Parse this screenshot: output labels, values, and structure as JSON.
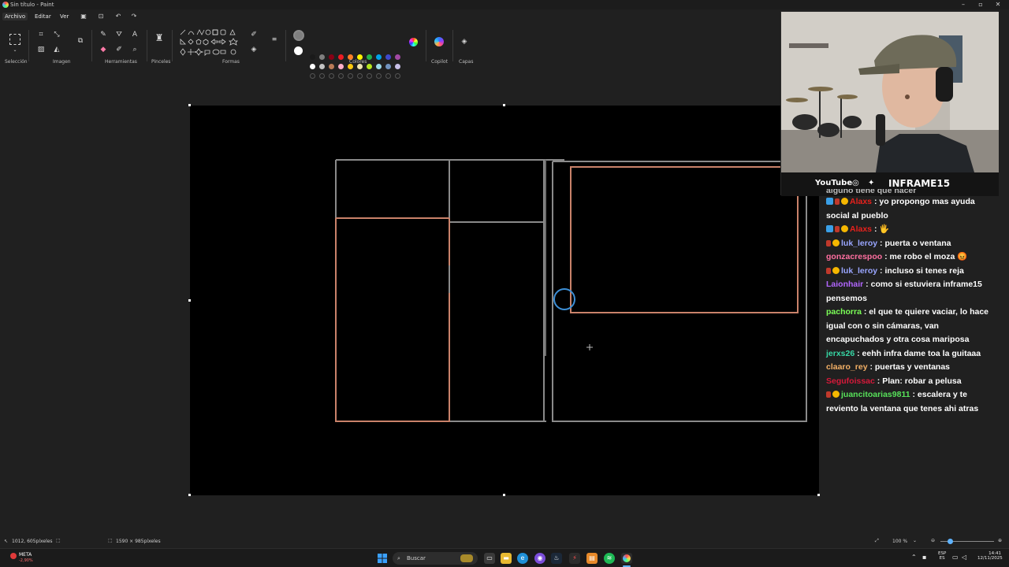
{
  "window": {
    "title": "Sin título - Paint"
  },
  "menu": {
    "file": "Archivo",
    "edit": "Editar",
    "view": "Ver"
  },
  "ribbon": {
    "groups": {
      "selection": "Selección",
      "image": "Imagen",
      "tools": "Herramientas",
      "brushes": "Pinceles",
      "shapes": "Formas",
      "colors": "Colores",
      "copilot": "Copilot",
      "layers": "Capas"
    },
    "palette_row1": [
      "#1a1a1a",
      "#7f7f7f",
      "#880015",
      "#ed1c24",
      "#ff7f27",
      "#fff200",
      "#22b14c",
      "#00a2e8",
      "#3f48cc",
      "#a349a4"
    ],
    "palette_row2": [
      "#ffffff",
      "#c3c3c3",
      "#b97a57",
      "#ffaec9",
      "#ffc90e",
      "#efe4b0",
      "#b5e61d",
      "#99d9ea",
      "#7092be",
      "#c8bfe7"
    ],
    "color1": "#7f7f7f",
    "color2": "#ffffff"
  },
  "statusbar": {
    "cursor_pos": "1012, 605píxeles",
    "canvas_size": "1590 × 985píxeles",
    "zoom": "100 %"
  },
  "webcam": {
    "youtube_label": "YouTube",
    "channel": "INFRAME15"
  },
  "chat": {
    "partial_top": "alguno tiene que hacer",
    "messages": [
      {
        "user": "Alaxs",
        "user_color": "#e8211c",
        "text": "yo propongo mas ayuda social al pueblo",
        "badges": [
          "cube",
          "sub",
          "one"
        ]
      },
      {
        "user": "Alaxs",
        "user_color": "#e8211c",
        "text": "🖐",
        "badges": [
          "cube",
          "sub",
          "one"
        ]
      },
      {
        "user": "luk_leroy",
        "user_color": "#9aa6ff",
        "text": "puerta o ventana",
        "badges": [
          "sub",
          "one"
        ]
      },
      {
        "user": "gonzacrespoo",
        "user_color": "#ff6fa0",
        "text": "me robo el moza 😡",
        "badges": []
      },
      {
        "user": "luk_leroy",
        "user_color": "#9aa6ff",
        "text": "incluso si tenes reja",
        "badges": [
          "sub",
          "one"
        ]
      },
      {
        "user": "Laionhair",
        "user_color": "#b266ff",
        "text": "como si estuviera inframe15 pensemos",
        "badges": []
      },
      {
        "user": "pachorra",
        "user_color": "#7bff57",
        "text": "el que te quiere vaciar, lo hace igual con o sin cámaras, van encapuchados y otra cosa mariposa",
        "badges": []
      },
      {
        "user": "jerxs26",
        "user_color": "#36d6a4",
        "text": "eehh infra dame toa la guitaaa",
        "badges": []
      },
      {
        "user": "claaro_rey",
        "user_color": "#f3b066",
        "text": "puertas y ventanas",
        "badges": []
      },
      {
        "user": "Segufoissac",
        "user_color": "#d6193a",
        "text": "Plan: robar a pelusa",
        "badges": []
      },
      {
        "user": "juancitoarias9811",
        "user_color": "#57e25a",
        "text": "escalera y te reviento la ventana que tenes ahi atras",
        "badges": [
          "sub",
          "one"
        ]
      }
    ]
  },
  "taskbar": {
    "search_placeholder": "Buscar",
    "stock_name": "META",
    "stock_change": "-2,90%",
    "lang_line1": "ESP",
    "lang_line2": "ES",
    "time": "14:41",
    "date": "12/11/2025"
  }
}
